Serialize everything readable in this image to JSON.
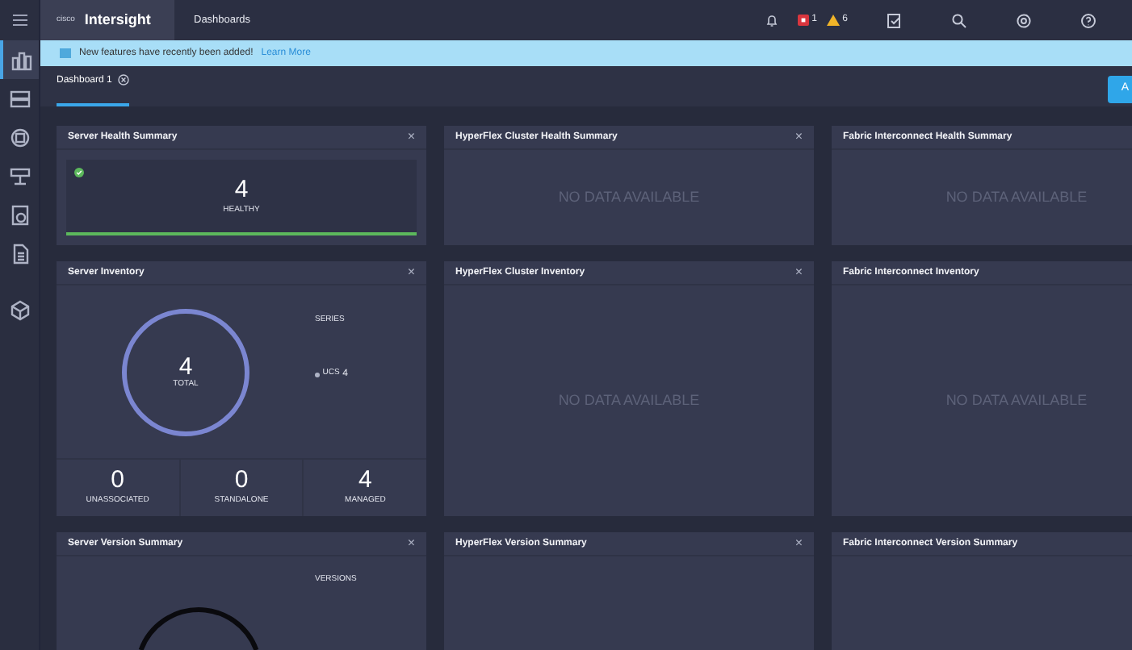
{
  "topbar": {
    "brand": "cisco",
    "app_name": "Intersight",
    "section": "Dashboards",
    "alerts": [
      {
        "kind": "critical",
        "count": "1"
      },
      {
        "kind": "warning",
        "count": "6"
      }
    ],
    "tools": [
      {
        "kind": "checklist"
      },
      {
        "kind": "search"
      },
      {
        "kind": "settings"
      },
      {
        "kind": "help"
      }
    ]
  },
  "sidebar": {
    "items": [
      {
        "kind": "dashboard",
        "selected": true
      },
      {
        "kind": "servers",
        "selected": false
      },
      {
        "kind": "cluster",
        "selected": false
      },
      {
        "kind": "network",
        "selected": false
      },
      {
        "kind": "profile",
        "selected": false
      },
      {
        "kind": "document",
        "selected": false
      },
      {
        "kind": "package",
        "selected": false
      }
    ]
  },
  "banner": {
    "text": "New features have recently been added!",
    "link": "Learn More"
  },
  "tabs": [
    {
      "label": "Dashboard 1",
      "selected": true
    }
  ],
  "add_button": {
    "label": "A"
  },
  "widgets": [
    {
      "kind": "health",
      "title": "Server Health Summary",
      "close": "×",
      "value": "4",
      "label": "HEALTHY",
      "level": 1
    },
    {
      "kind": "empty",
      "title": "HyperFlex Cluster Health Summary",
      "close": "×",
      "message": "NO DATA AVAILABLE"
    },
    {
      "kind": "empty",
      "title": "Fabric Interconnect Health Summary",
      "message": "NO DATA AVAILABLE"
    },
    {
      "kind": "inventory",
      "title": "Server Inventory",
      "close": "×",
      "total": "4",
      "total_label": "TOTAL",
      "legend_title": "SERIES",
      "legend": [
        {
          "label": "UCS",
          "count": "4"
        }
      ],
      "stats": [
        {
          "value": "0",
          "label": "UNASSOCIATED"
        },
        {
          "value": "0",
          "label": "STANDALONE"
        },
        {
          "value": "4",
          "label": "MANAGED"
        }
      ]
    },
    {
      "kind": "empty",
      "title": "HyperFlex Cluster Inventory",
      "close": "×",
      "message": "NO DATA AVAILABLE"
    },
    {
      "kind": "empty",
      "title": "Fabric Interconnect Inventory",
      "message": "NO DATA AVAILABLE"
    },
    {
      "kind": "version",
      "title": "Server Version Summary",
      "close": "×",
      "legend_title": "VERSIONS"
    },
    {
      "kind": "blank",
      "title": "HyperFlex Version Summary",
      "close": "×"
    },
    {
      "kind": "blank",
      "title": "Fabric Interconnect Version Summary"
    }
  ]
}
